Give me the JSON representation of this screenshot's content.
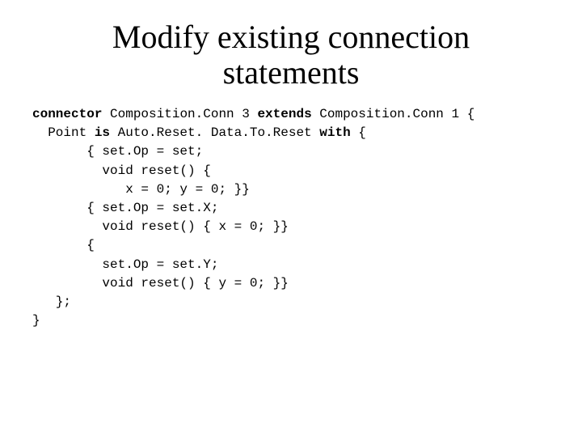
{
  "title": "Modify existing connection statements",
  "code": {
    "kw_connector": "connector",
    "conn3": " Composition.Conn 3 ",
    "kw_extends": "extends",
    "conn1": " Composition.Conn 1 {",
    "l2a": "  Point ",
    "kw_is": "is",
    "l2b": " Auto.Reset. Data.To.Reset ",
    "kw_with": "with",
    "l2c": " {",
    "l3": "       { set.Op = set;",
    "l4": "         void reset() {",
    "l5": "            x = 0; y = 0; }}",
    "l6": "       { set.Op = set.X;",
    "l7": "         void reset() { x = 0; }}",
    "l8": "       {",
    "l9": "         set.Op = set.Y;",
    "l10": "         void reset() { y = 0; }}",
    "l11": "   };",
    "l12": "}"
  }
}
